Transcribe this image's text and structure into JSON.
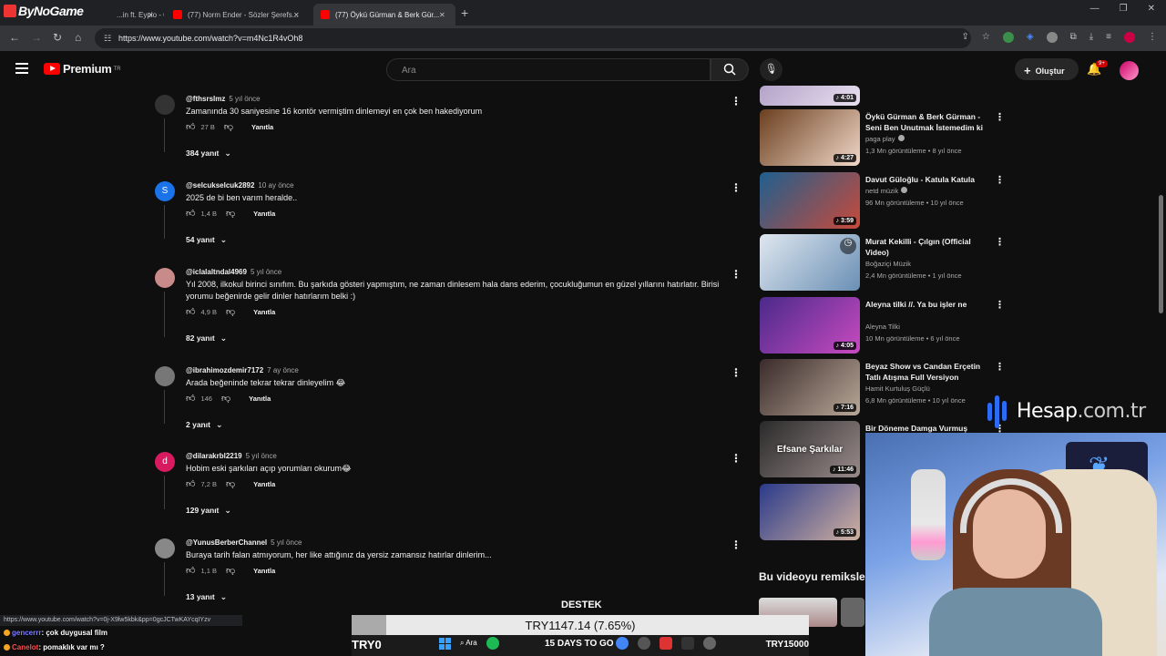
{
  "browser": {
    "brand": "ByNoGame",
    "tabs": [
      {
        "title": "...in ft. Eypio - Otu..."
      },
      {
        "title": "(77) Norm Ender - Sözler Şerefs..."
      },
      {
        "title": "(77) Öykü Gürman & Berk Gür..."
      }
    ],
    "url": "https://www.youtube.com/watch?v=m4Nc1R4vOh8"
  },
  "youtube": {
    "logo_text": "Premium",
    "region": "TR",
    "search_placeholder": "Ara",
    "create_label": "Oluştur",
    "notif_count": "9+"
  },
  "comments": [
    {
      "handle": "@fthsrslmz",
      "time": "5 yıl önce",
      "text": "Zamanında 30 saniyesine 16 kontör vermiştim dinlemeyi en çok ben hakediyorum",
      "likes": "27 B",
      "reply": "Yanıtla",
      "replies": "384 yanıt",
      "avatar_letter": "",
      "avatar_color": "#333"
    },
    {
      "handle": "@selcukselcuk2892",
      "time": "10 ay önce",
      "text": "2025 de bi ben varım heralde..",
      "likes": "1,4 B",
      "reply": "Yanıtla",
      "replies": "54 yanıt",
      "avatar_letter": "S",
      "avatar_color": "#1a73e8"
    },
    {
      "handle": "@iclalaltndal4969",
      "time": "5 yıl önce",
      "text": "Yıl 2008, ilkokul birinci sınıfım. Bu şarkıda gösteri yapmıştım, ne zaman dinlesem hala dans ederim, çocukluğumun en güzel yıllarını hatırlatır. Birisi yorumu beğenirde gelir dinler hatırlarım  belki :)",
      "likes": "4,9 B",
      "reply": "Yanıtla",
      "replies": "82 yanıt",
      "avatar_letter": "",
      "avatar_color": "#c98a8a"
    },
    {
      "handle": "@ibrahimozdemir7172",
      "time": "7 ay önce",
      "text": "Arada beğeninde tekrar tekrar dinleyelim 😂",
      "likes": "146",
      "reply": "Yanıtla",
      "replies": "2 yanıt",
      "avatar_letter": "",
      "avatar_color": "#777"
    },
    {
      "handle": "@dilarakrbl2219",
      "time": "5 yıl önce",
      "text": "Hobim eski şarkıları açıp yorumları okurum😂",
      "likes": "7,2 B",
      "reply": "Yanıtla",
      "replies": "129 yanıt",
      "avatar_letter": "d",
      "avatar_color": "#d81b60"
    },
    {
      "handle": "@YunusBerberChannel",
      "time": "5 yıl önce",
      "text": "Buraya tarih falan atmıyorum, her like attığınız da yersiz zamansız hatırlar dinlerim...",
      "likes": "1,1 B",
      "reply": "Yanıtla",
      "replies": "13 yanıt",
      "avatar_letter": "",
      "avatar_color": "#888"
    }
  ],
  "sidebar": {
    "videos": [
      {
        "title": "",
        "channel": "",
        "meta": "",
        "duration": "4:01",
        "colors": [
          "#b4a3c8",
          "#e8e0f0"
        ]
      },
      {
        "title": "Öykü Gürman & Berk Gürman - Seni Ben Unutmak İstemedim ki",
        "channel": "paga play",
        "meta": "1,3 Mn görüntüleme • 8 yıl önce",
        "duration": "4:27",
        "colors": [
          "#6b3f1f",
          "#f0d8c8"
        ]
      },
      {
        "title": "Davut Güloğlu - Katula Katula",
        "channel": "netd müzik",
        "meta": "96 Mn görüntüleme • 10 yıl önce",
        "duration": "3:59",
        "colors": [
          "#1f5f8f",
          "#c84a3a"
        ]
      },
      {
        "title": "Murat Kekilli - Çılgın (Official Video)",
        "channel": "Boğaziçi Müzik",
        "meta": "2,4 Mn görüntüleme • 1 yıl önce",
        "duration": "",
        "colors": [
          "#dfe7ef",
          "#6a8fb5"
        ]
      },
      {
        "title": "Aleyna tilki //. Ya bu işler ne",
        "channel": "Aleyna Tilki",
        "meta": "10 Mn görüntüleme • 6 yıl önce",
        "duration": "4:05",
        "colors": [
          "#4a2a8a",
          "#c84ac0"
        ]
      },
      {
        "title": "Beyaz Show vs Candan Erçetin Tatlı Atışma Full Versiyon",
        "channel": "Hamit Kurtuluş Güçlü",
        "meta": "6,8 Mn görüntüleme • 10 yıl önce",
        "duration": "7:16",
        "colors": [
          "#3a2a2a",
          "#b8a898"
        ]
      },
      {
        "title": "Bir Döneme Damga Vurmuş",
        "channel": "",
        "meta": "",
        "duration": "11:46",
        "colors": [
          "#2a2a2a",
          "#9a8a8a"
        ],
        "overlay": "Efsane Şarkılar"
      },
      {
        "title": "",
        "channel": "",
        "meta": "",
        "duration": "5:53",
        "colors": [
          "#2a3a8a",
          "#d0b0a0"
        ]
      }
    ],
    "remix_title": "Bu videoyu remiksle"
  },
  "overlay": {
    "sponsor_name": "Hesap",
    "sponsor_tld": ".com.tr",
    "status_url": "https://www.youtube.com/watch?v=0j-X9lw5kbk&pp=0gcJCTwKAYcqIYzv",
    "chat": [
      {
        "user": "gencerrr",
        "msg": ": çok duygusal film"
      },
      {
        "user": "Canelot",
        "msg": ": pomaklık var mı ?"
      }
    ],
    "destek_label": "DESTEK",
    "donation_text": "TRY1147.14 (7.65%)",
    "donation_progress": 0.0765,
    "goal_start": "TRY0",
    "goal_end": "TRY15000",
    "taskbar_search": "Ara",
    "promo_text": "15 DAYS TO GO"
  }
}
